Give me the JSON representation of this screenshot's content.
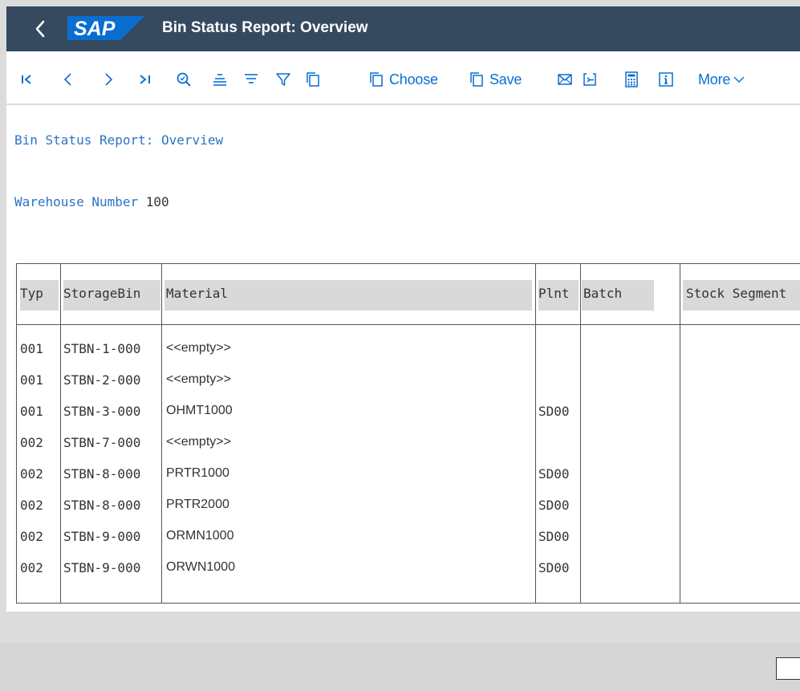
{
  "header": {
    "title": "Bin Status Report: Overview",
    "logo_text": "SAP",
    "bg_color": "#354a5f",
    "logo_color": "#0a6ed1"
  },
  "toolbar": {
    "accent_color": "#0a6ed1",
    "items": [
      {
        "name": "first-page",
        "icon": "first-page-icon"
      },
      {
        "name": "previous-page",
        "icon": "chevron-left-icon"
      },
      {
        "name": "next-page",
        "icon": "chevron-right-icon"
      },
      {
        "name": "last-page",
        "icon": "last-page-icon"
      },
      {
        "name": "find",
        "icon": "search-icon"
      },
      {
        "name": "sort-ascending",
        "icon": "sort-ascending-icon"
      },
      {
        "name": "sort-descending",
        "icon": "sort-descending-icon"
      },
      {
        "name": "filter",
        "icon": "filter-icon"
      },
      {
        "name": "copy",
        "icon": "copy-icon"
      }
    ],
    "choose_label": "Choose",
    "save_label": "Save",
    "more_label": "More"
  },
  "report": {
    "title": "Bin Status Report: Overview",
    "warehouse_label": "Warehouse Number",
    "warehouse_value": "100"
  },
  "table": {
    "columns": [
      "Typ",
      "StorageBin",
      "Material",
      "Plnt",
      "Batch",
      "Stock Segment"
    ],
    "rows": [
      {
        "typ": "001",
        "bin": "STBN-1-000",
        "material": "<<empty>>",
        "plant": ""
      },
      {
        "typ": "001",
        "bin": "STBN-2-000",
        "material": "<<empty>>",
        "plant": ""
      },
      {
        "typ": "001",
        "bin": "STBN-3-000",
        "material": "OHMT1000",
        "plant": "SD00"
      },
      {
        "typ": "002",
        "bin": "STBN-7-000",
        "material": "<<empty>>",
        "plant": ""
      },
      {
        "typ": "002",
        "bin": "STBN-8-000",
        "material": "PRTR1000",
        "plant": "SD00"
      },
      {
        "typ": "002",
        "bin": "STBN-8-000",
        "material": "PRTR2000",
        "plant": "SD00"
      },
      {
        "typ": "002",
        "bin": "STBN-9-000",
        "material": "ORMN1000",
        "plant": "SD00"
      },
      {
        "typ": "002",
        "bin": "STBN-9-000",
        "material": "ORWN1000",
        "plant": "SD00"
      }
    ]
  }
}
